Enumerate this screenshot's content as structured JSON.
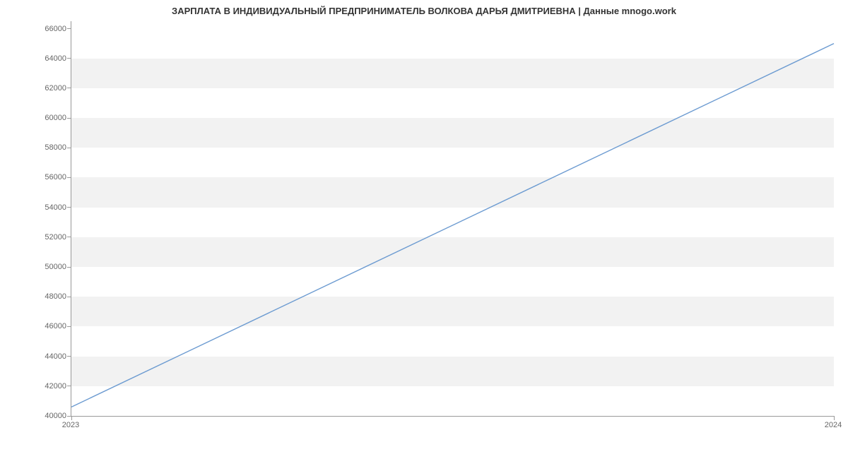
{
  "chart_data": {
    "type": "line",
    "title": "ЗАРПЛАТА В ИНДИВИДУАЛЬНЫЙ ПРЕДПРИНИМАТЕЛЬ  ВОЛКОВА ДАРЬЯ ДМИТРИЕВНА | Данные mnogo.work",
    "xlabel": "",
    "ylabel": "",
    "x": [
      "2023",
      "2024"
    ],
    "series": [
      {
        "name": "salary",
        "values": [
          40600,
          65000
        ],
        "color": "#6c9bd1"
      }
    ],
    "y_ticks": [
      40000,
      42000,
      44000,
      46000,
      48000,
      50000,
      52000,
      54000,
      56000,
      58000,
      60000,
      62000,
      64000,
      66000
    ],
    "x_ticks": [
      "2023",
      "2024"
    ],
    "ylim": [
      40000,
      66500
    ],
    "xlim": [
      "2023",
      "2024"
    ],
    "grid": "banded"
  }
}
